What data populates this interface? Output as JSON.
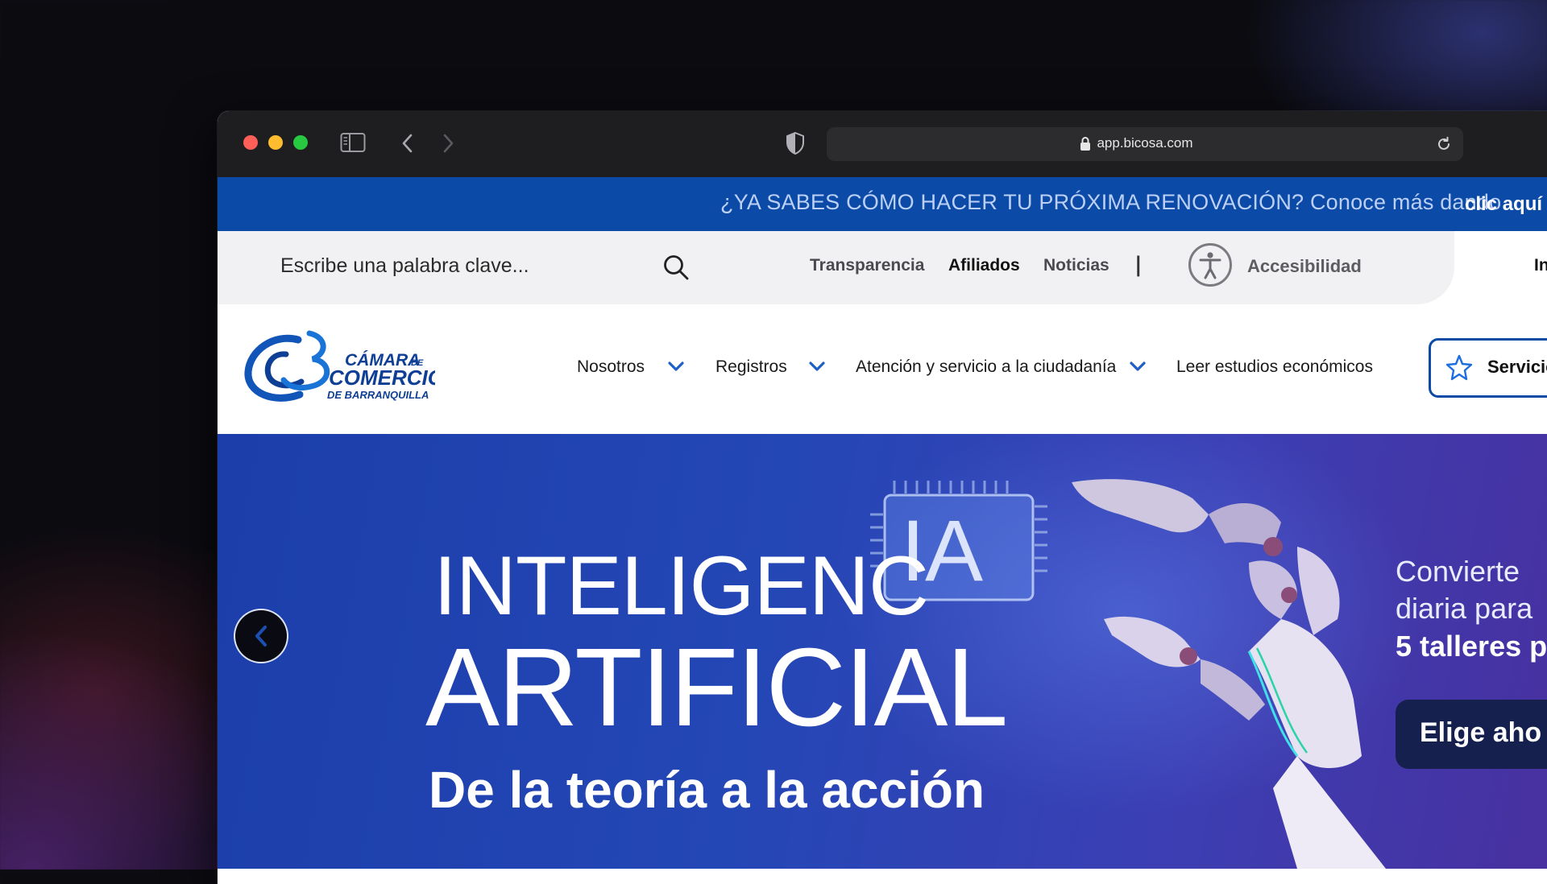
{
  "browser": {
    "url": "app.bicosa.com",
    "icons": [
      "sidebar-icon",
      "back-icon",
      "forward-icon",
      "shield-icon",
      "lock-icon",
      "reload-icon"
    ]
  },
  "announcement": {
    "text": "¿YA SABES CÓMO HACER TU PRÓXIMA RENOVACIÓN? Conoce más dando",
    "link": "clic aquí"
  },
  "utility_bar": {
    "search_placeholder": "Escribe una palabra clave...",
    "links": [
      "Transparencia",
      "Afiliados",
      "Noticias"
    ],
    "separator": "|",
    "accessibility": "Accesibilidad",
    "right_cut": "In"
  },
  "logo": {
    "line1": "CÁMARA",
    "line1_small": "DE",
    "line2": "COMERCIO",
    "line3": "DE BARRANQUILLA"
  },
  "main_nav": {
    "items": [
      "Nosotros",
      "Registros",
      "Atención y servicio a la ciudadanía",
      "Leer estudios económicos"
    ],
    "services_button": "Servicio"
  },
  "hero": {
    "line1": "INTELIGENC",
    "ia_chip": "IA",
    "line2": "ARTIFICIAL",
    "line3": "De la teoría a la acción",
    "side_line1": "Convierte",
    "side_line2": "diaria para",
    "side_line3": "5 talleres p",
    "cta": "Elige aho"
  },
  "colors": {
    "brand_blue": "#0b4aa6",
    "banner_text": "#bcd0f5",
    "hero_start": "#1b3eaa",
    "hero_end": "#4a2f9e"
  }
}
